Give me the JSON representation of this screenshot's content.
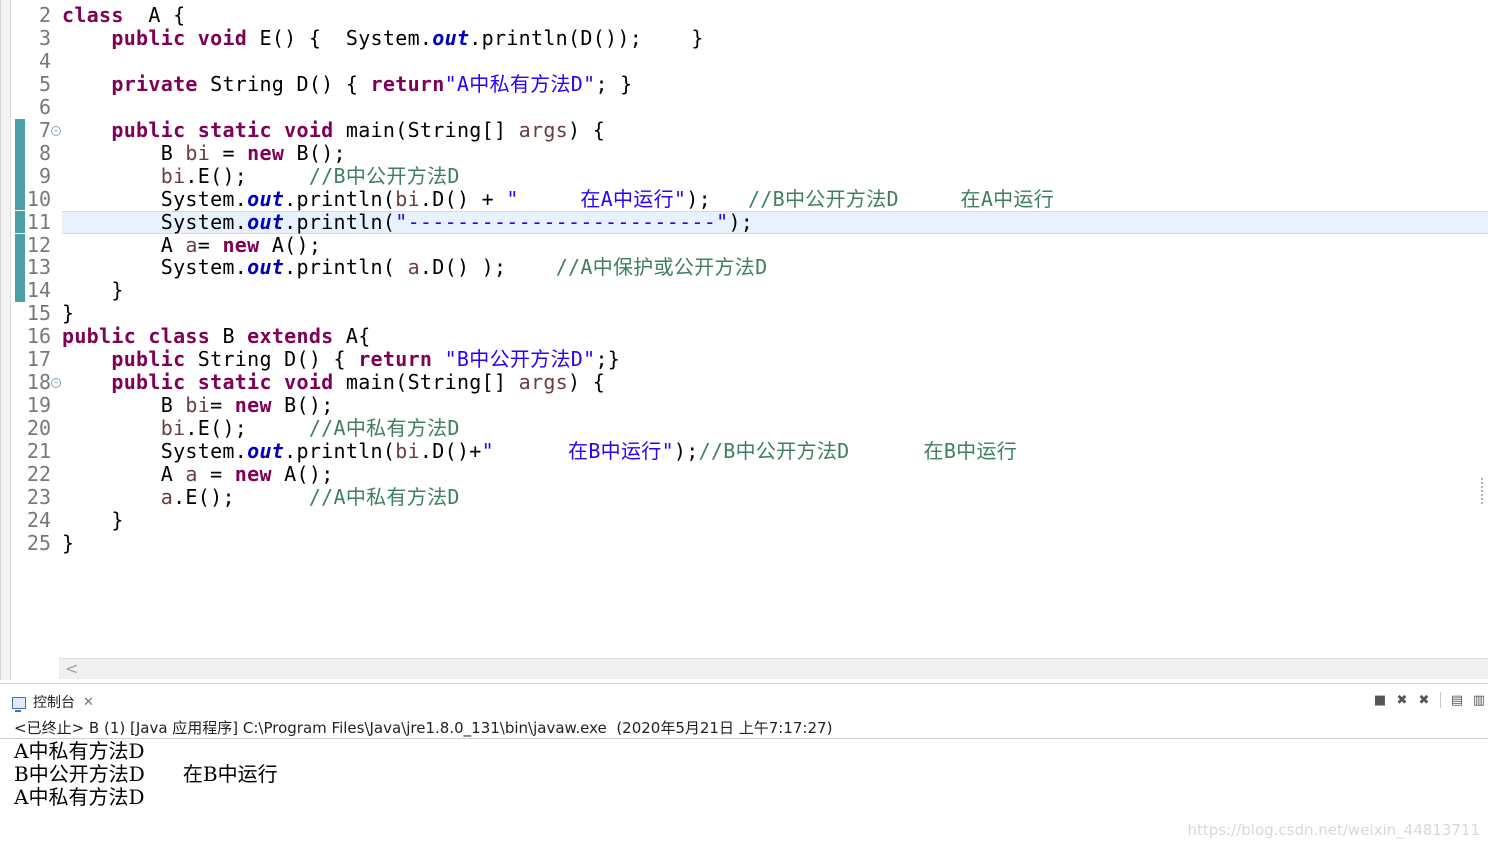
{
  "editor": {
    "current_line": 11,
    "modified_lines": [
      7,
      8,
      9,
      10,
      11,
      12,
      13,
      14
    ],
    "fold_lines": [
      7,
      18
    ],
    "lines": [
      {
        "n": "2",
        "tokens": [
          [
            "kw",
            "class"
          ],
          [
            "",
            "  A {"
          ]
        ]
      },
      {
        "n": "3",
        "tokens": [
          [
            "",
            "    "
          ],
          [
            "kw",
            "public"
          ],
          [
            "",
            " "
          ],
          [
            "kw",
            "void"
          ],
          [
            "",
            " E() {  System."
          ],
          [
            "fld",
            "out"
          ],
          [
            "",
            ".println(D());    }"
          ]
        ]
      },
      {
        "n": "4",
        "tokens": []
      },
      {
        "n": "5",
        "tokens": [
          [
            "",
            "    "
          ],
          [
            "kw",
            "private"
          ],
          [
            "",
            " String D() { "
          ],
          [
            "kw",
            "return"
          ],
          [
            "str",
            "\"A中私有方法D\""
          ],
          [
            "",
            "; }"
          ]
        ]
      },
      {
        "n": "6",
        "tokens": []
      },
      {
        "n": "7",
        "tokens": [
          [
            "",
            "    "
          ],
          [
            "kw",
            "public"
          ],
          [
            "",
            " "
          ],
          [
            "kw",
            "static"
          ],
          [
            "",
            " "
          ],
          [
            "kw",
            "void"
          ],
          [
            "",
            " main(String[] "
          ],
          [
            "par",
            "args"
          ],
          [
            "",
            ") {"
          ]
        ]
      },
      {
        "n": "8",
        "tokens": [
          [
            "",
            "        B "
          ],
          [
            "par",
            "bi"
          ],
          [
            "",
            " = "
          ],
          [
            "kw",
            "new"
          ],
          [
            "",
            " B();"
          ]
        ]
      },
      {
        "n": "9",
        "tokens": [
          [
            "",
            "        "
          ],
          [
            "par",
            "bi"
          ],
          [
            "",
            ".E();     "
          ],
          [
            "cm",
            "//B中公开方法D"
          ]
        ]
      },
      {
        "n": "10",
        "tokens": [
          [
            "",
            "        System."
          ],
          [
            "fld",
            "out"
          ],
          [
            "",
            ".println("
          ],
          [
            "par",
            "bi"
          ],
          [
            "",
            ".D() + "
          ],
          [
            "str",
            "\"     在A中运行\""
          ],
          [
            "",
            ");   "
          ],
          [
            "cm",
            "//B中公开方法D     在A中运行"
          ]
        ]
      },
      {
        "n": "11",
        "tokens": [
          [
            "",
            "        System."
          ],
          [
            "fld",
            "out"
          ],
          [
            "",
            ".println("
          ],
          [
            "str",
            "\"-------------------------\""
          ],
          [
            "",
            ");"
          ]
        ]
      },
      {
        "n": "12",
        "tokens": [
          [
            "",
            "        A "
          ],
          [
            "par",
            "a"
          ],
          [
            "",
            "= "
          ],
          [
            "kw",
            "new"
          ],
          [
            "",
            " A();"
          ]
        ]
      },
      {
        "n": "13",
        "tokens": [
          [
            "",
            "        System."
          ],
          [
            "fld",
            "out"
          ],
          [
            "",
            ".println( "
          ],
          [
            "par",
            "a"
          ],
          [
            "",
            ".D() );    "
          ],
          [
            "cm",
            "//A中保护或公开方法D"
          ]
        ]
      },
      {
        "n": "14",
        "tokens": [
          [
            "",
            "    }"
          ]
        ]
      },
      {
        "n": "15",
        "tokens": [
          [
            "",
            "}"
          ]
        ]
      },
      {
        "n": "16",
        "tokens": [
          [
            "kw",
            "public"
          ],
          [
            "",
            " "
          ],
          [
            "kw",
            "class"
          ],
          [
            "",
            " B "
          ],
          [
            "kw",
            "extends"
          ],
          [
            "",
            " A{"
          ]
        ]
      },
      {
        "n": "17",
        "tokens": [
          [
            "",
            "    "
          ],
          [
            "kw",
            "public"
          ],
          [
            "",
            " String D() { "
          ],
          [
            "kw",
            "return"
          ],
          [
            "",
            " "
          ],
          [
            "str",
            "\"B中公开方法D\""
          ],
          [
            "",
            ";}"
          ]
        ]
      },
      {
        "n": "18",
        "tokens": [
          [
            "",
            "    "
          ],
          [
            "kw",
            "public"
          ],
          [
            "",
            " "
          ],
          [
            "kw",
            "static"
          ],
          [
            "",
            " "
          ],
          [
            "kw",
            "void"
          ],
          [
            "",
            " main(String[] "
          ],
          [
            "par",
            "args"
          ],
          [
            "",
            ") {"
          ]
        ]
      },
      {
        "n": "19",
        "tokens": [
          [
            "",
            "        B "
          ],
          [
            "par",
            "bi"
          ],
          [
            "",
            "= "
          ],
          [
            "kw",
            "new"
          ],
          [
            "",
            " B();"
          ]
        ]
      },
      {
        "n": "20",
        "tokens": [
          [
            "",
            "        "
          ],
          [
            "par",
            "bi"
          ],
          [
            "",
            ".E();     "
          ],
          [
            "cm",
            "//A中私有方法D"
          ]
        ]
      },
      {
        "n": "21",
        "tokens": [
          [
            "",
            "        System."
          ],
          [
            "fld",
            "out"
          ],
          [
            "",
            ".println("
          ],
          [
            "par",
            "bi"
          ],
          [
            "",
            ".D()+"
          ],
          [
            "str",
            "\"      在B中运行\""
          ],
          [
            "",
            ");"
          ],
          [
            "cm",
            "//B中公开方法D      在B中运行"
          ]
        ]
      },
      {
        "n": "22",
        "tokens": [
          [
            "",
            "        A "
          ],
          [
            "par",
            "a"
          ],
          [
            "",
            " = "
          ],
          [
            "kw",
            "new"
          ],
          [
            "",
            " A();"
          ]
        ]
      },
      {
        "n": "23",
        "tokens": [
          [
            "",
            "        "
          ],
          [
            "par",
            "a"
          ],
          [
            "",
            ".E();      "
          ],
          [
            "cm",
            "//A中私有方法D"
          ]
        ]
      },
      {
        "n": "24",
        "tokens": [
          [
            "",
            "    }"
          ]
        ]
      },
      {
        "n": "25",
        "tokens": [
          [
            "",
            "}"
          ]
        ]
      }
    ]
  },
  "console": {
    "tab_label": "控制台",
    "tab_close": "✕",
    "status": "<已终止> B (1) [Java 应用程序] C:\\Program Files\\Java\\jre1.8.0_131\\bin\\javaw.exe  (2020年5月21日 上午7:17:27)",
    "output": [
      "A中私有方法D",
      "B中公开方法D      在B中运行",
      "A中私有方法D"
    ],
    "toolbar": [
      {
        "name": "terminate-icon",
        "glyph": "■"
      },
      {
        "name": "remove-launch-icon",
        "glyph": "✖"
      },
      {
        "name": "remove-all-icon",
        "glyph": "✖"
      },
      {
        "name": "clear-console-icon",
        "glyph": "▤"
      },
      {
        "name": "scroll-lock-icon",
        "glyph": "▥"
      }
    ]
  },
  "scroll_left_glyph": "<",
  "watermark": "https://blog.csdn.net/weixin_44813711"
}
